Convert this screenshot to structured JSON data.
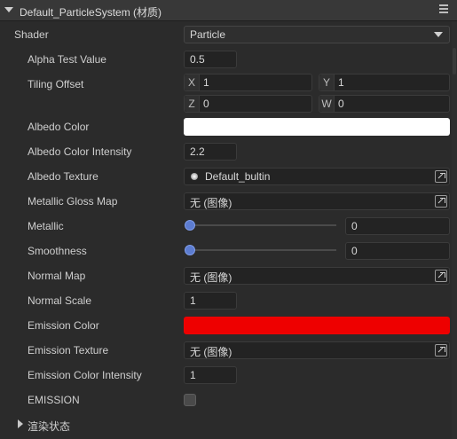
{
  "header": {
    "title": "Default_ParticleSystem (材质)",
    "menu_icon": "hamburger-menu-icon"
  },
  "shader": {
    "label": "Shader",
    "value": "Particle"
  },
  "alpha_test": {
    "label": "Alpha Test Value",
    "value": "0.5"
  },
  "tiling_offset": {
    "label": "Tiling Offset",
    "x": {
      "axis": "X",
      "value": "1"
    },
    "y": {
      "axis": "Y",
      "value": "1"
    },
    "z": {
      "axis": "Z",
      "value": "0"
    },
    "w": {
      "axis": "W",
      "value": "0"
    }
  },
  "albedo_color": {
    "label": "Albedo Color",
    "color": "#ffffff"
  },
  "albedo_intensity": {
    "label": "Albedo Color Intensity",
    "value": "2.2"
  },
  "albedo_texture": {
    "label": "Albedo Texture",
    "value": "Default_bultin"
  },
  "metallic_gloss_map": {
    "label": "Metallic Gloss Map",
    "value": "无 (图像)"
  },
  "metallic": {
    "label": "Metallic",
    "value": "0",
    "slider_fraction": 0
  },
  "smoothness": {
    "label": "Smoothness",
    "value": "0",
    "slider_fraction": 0
  },
  "normal_map": {
    "label": "Normal Map",
    "value": "无 (图像)"
  },
  "normal_scale": {
    "label": "Normal Scale",
    "value": "1"
  },
  "emission_color": {
    "label": "Emission Color",
    "color": "#ee0000"
  },
  "emission_texture": {
    "label": "Emission Texture",
    "value": "无 (图像)"
  },
  "emission_intensity": {
    "label": "Emission Color Intensity",
    "value": "1"
  },
  "emission": {
    "label": "EMISSION",
    "checked": false
  },
  "render_state": {
    "label": "渲染状态"
  }
}
